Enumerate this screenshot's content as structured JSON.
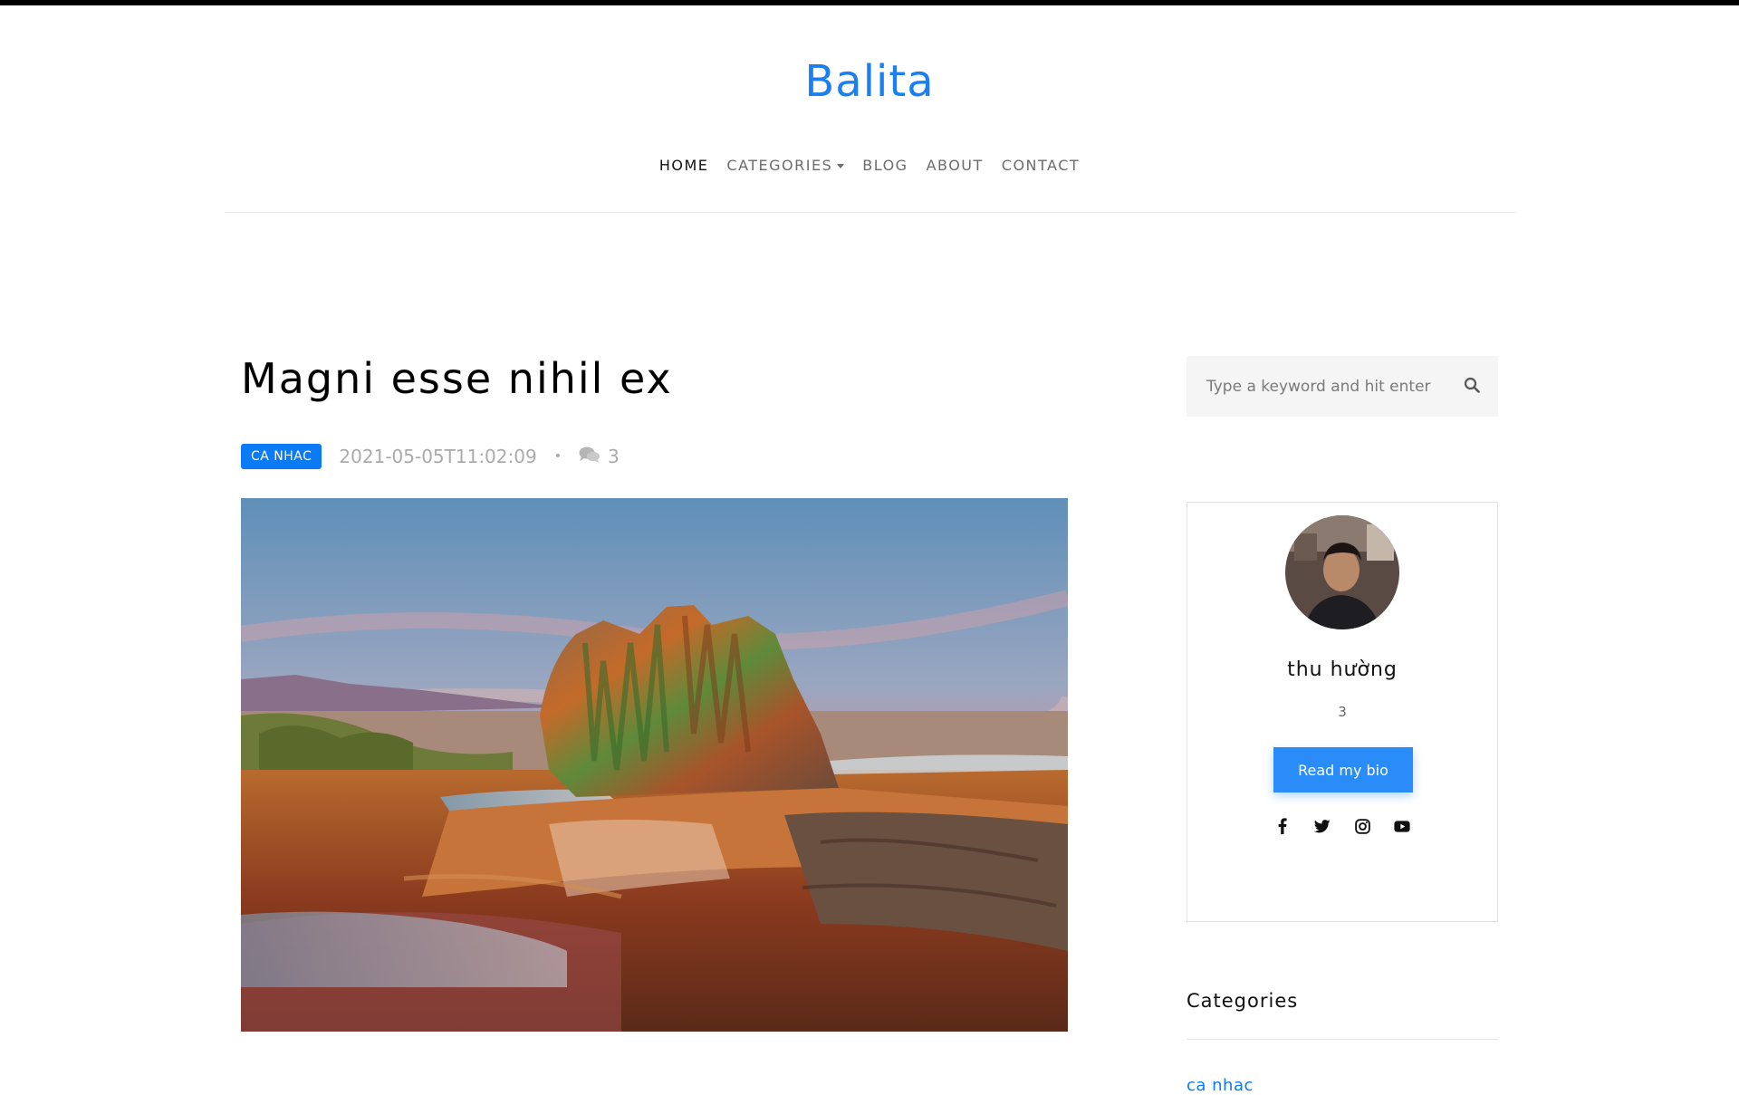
{
  "site": {
    "brand": "Balita"
  },
  "nav": {
    "home": "HOME",
    "categories": "CATEGORIES",
    "blog": "BLOG",
    "about": "ABOUT",
    "contact": "CONTACT"
  },
  "post": {
    "title": "Magni esse nihil ex",
    "category_badge": "CA NHAC",
    "date": "2021-05-05T11:02:09",
    "separator": "•",
    "comment_count": "3",
    "image_icon": "geyser-landscape-photo"
  },
  "sidebar": {
    "search": {
      "placeholder": "Type a keyword and hit enter",
      "icon": "search-icon"
    },
    "bio": {
      "name": "thu hường",
      "count": "3",
      "button_label": "Read my bio",
      "socials": [
        "facebook-icon",
        "twitter-icon",
        "instagram-icon",
        "youtube-icon"
      ]
    },
    "categories": {
      "heading": "Categories",
      "items": [
        "ca nhac"
      ]
    }
  },
  "colors": {
    "brand": "#1a7ff0",
    "badge": "#0a7bf4",
    "button": "#2a8cf8",
    "link": "#0a7bf4"
  }
}
